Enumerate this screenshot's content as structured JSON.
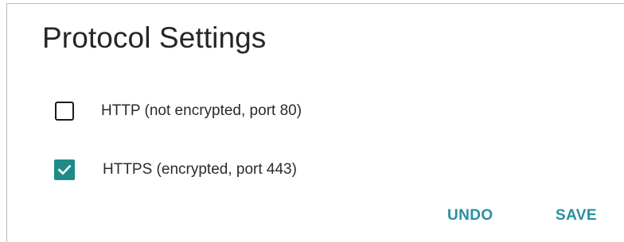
{
  "dialog": {
    "title": "Protocol Settings"
  },
  "options": [
    {
      "label": "HTTP (not encrypted, port 80)",
      "checked": false
    },
    {
      "label": "HTTPS (encrypted, port 443)",
      "checked": true
    }
  ],
  "actions": {
    "undo_label": "UNDO",
    "save_label": "SAVE"
  },
  "colors": {
    "accent": "#1f8a8a",
    "button_text": "#2a8fa0",
    "title_text": "#262626",
    "border": "#b9b9b9"
  },
  "icons": {
    "checked": "checkmark-icon"
  }
}
